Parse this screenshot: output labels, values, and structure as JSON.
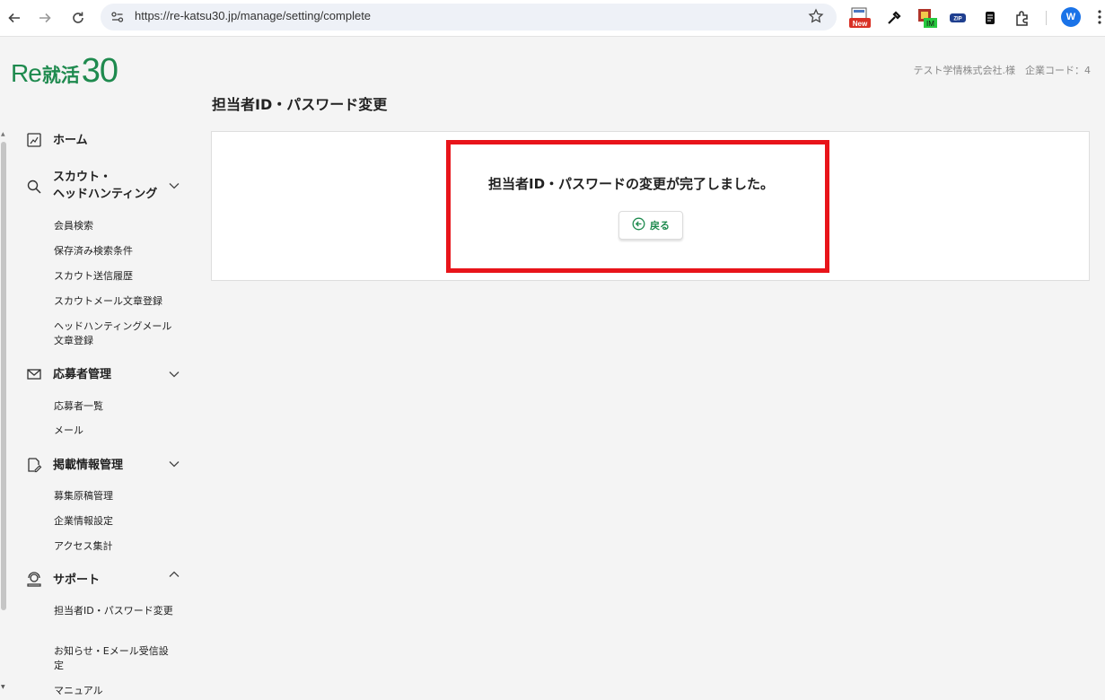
{
  "browser": {
    "url": "https://re-katsu30.jp/manage/setting/complete",
    "new_badge": "New",
    "im_badge": "IM",
    "zip_badge": "ZIP",
    "profile_initial": "W"
  },
  "logo": {
    "re": "Re",
    "kanji": "就活",
    "number": "30"
  },
  "header": {
    "company": "テスト学情株式会社.様　企業コード：4"
  },
  "page": {
    "title": "担当者ID・パスワード変更",
    "message": "担当者ID・パスワードの変更が完了しました。",
    "back_label": "戻る"
  },
  "sidebar": {
    "home": "ホーム",
    "scout": {
      "label_line1": "スカウト・",
      "label_line2": "ヘッドハンティング",
      "items": [
        "会員検索",
        "保存済み検索条件",
        "スカウト送信履歴",
        "スカウトメール文章登録",
        "ヘッドハンティングメール文章登録"
      ]
    },
    "applicants": {
      "label": "応募者管理",
      "items": [
        "応募者一覧",
        "メール"
      ]
    },
    "postings": {
      "label": "掲載情報管理",
      "items": [
        "募集原稿管理",
        "企業情報設定",
        "アクセス集計"
      ]
    },
    "support": {
      "label": "サポート",
      "items": [
        "担当者ID・パスワード変更",
        "お知らせ・Eメール受信設定",
        "マニュアル"
      ]
    }
  },
  "colors": {
    "brand": "#1e8a4e",
    "highlight": "#e8141a",
    "profile": "#1a73e8"
  }
}
